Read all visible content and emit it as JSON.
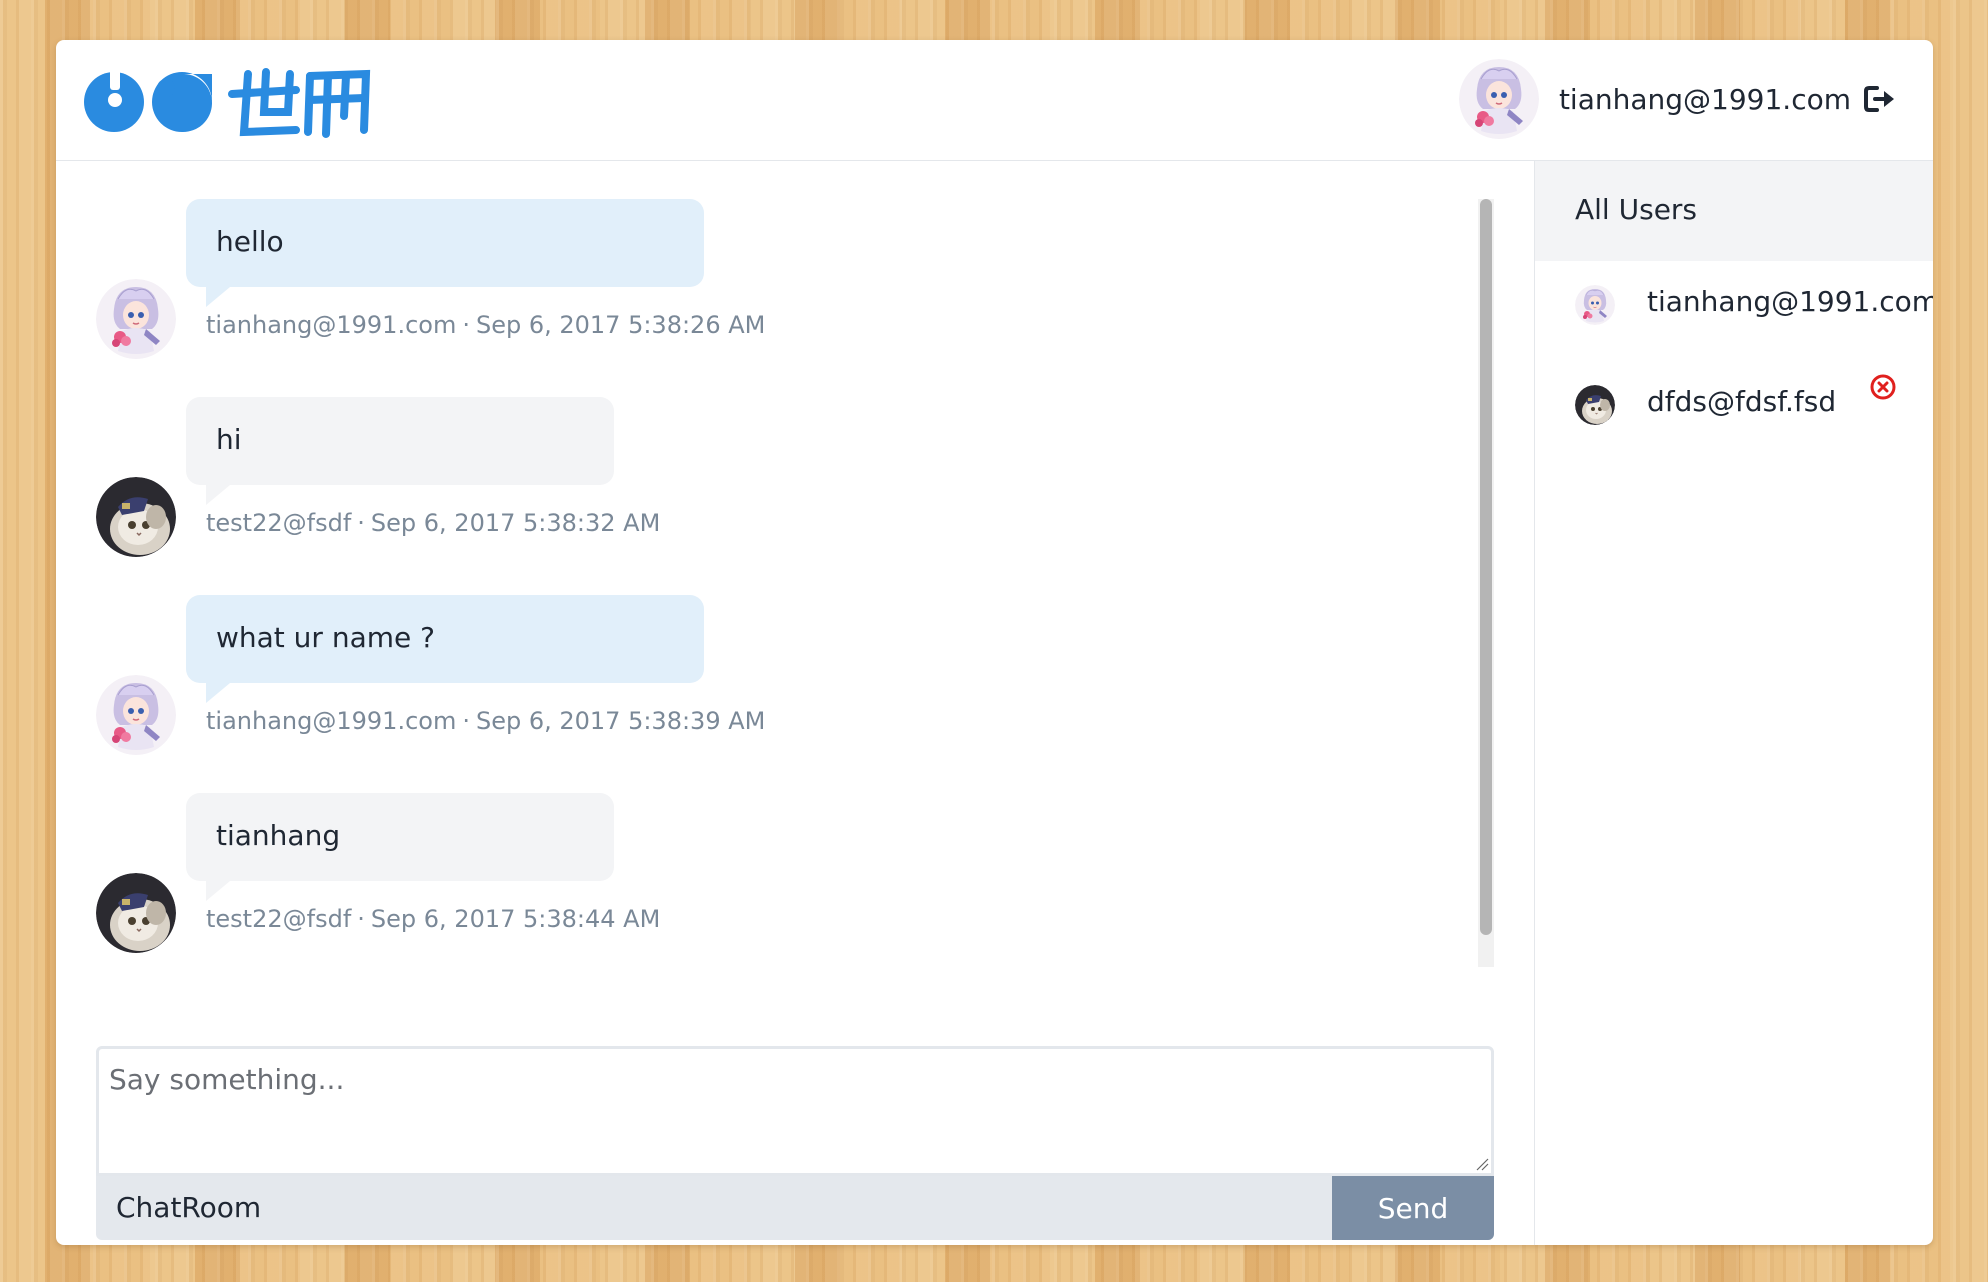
{
  "brand": {
    "logo_alt": "世界 logo",
    "logo_text": "世界",
    "logo_color": "#2a8be0"
  },
  "header": {
    "current_user": "tianhang@1991.com",
    "logout_icon": "logout-icon"
  },
  "messages": [
    {
      "text": "hello",
      "author": "tianhang@1991.com",
      "time": "Sep 6, 2017 5:38:26 AM",
      "self": true
    },
    {
      "text": "hi",
      "author": "test22@fsdf",
      "time": "Sep 6, 2017 5:38:32 AM",
      "self": false
    },
    {
      "text": "what ur name ?",
      "author": "tianhang@1991.com",
      "time": "Sep 6, 2017 5:38:39 AM",
      "self": true
    },
    {
      "text": "tianhang",
      "author": "test22@fsdf",
      "time": "Sep 6, 2017 5:38:44 AM",
      "self": false
    }
  ],
  "meta_separator": "·",
  "composer": {
    "placeholder": "Say something...",
    "room_label": "ChatRoom",
    "send_label": "Send"
  },
  "sidebar": {
    "title": "All Users",
    "users": [
      {
        "name": "tianhang@1991.com",
        "online": true
      },
      {
        "name": "dfds@fdsf.fsd",
        "online": false
      }
    ]
  },
  "colors": {
    "self_bubble": "#e1effa",
    "other_bubble": "#f3f4f6",
    "send_button": "#7b8ea5",
    "offline_red": "#e0201e"
  }
}
